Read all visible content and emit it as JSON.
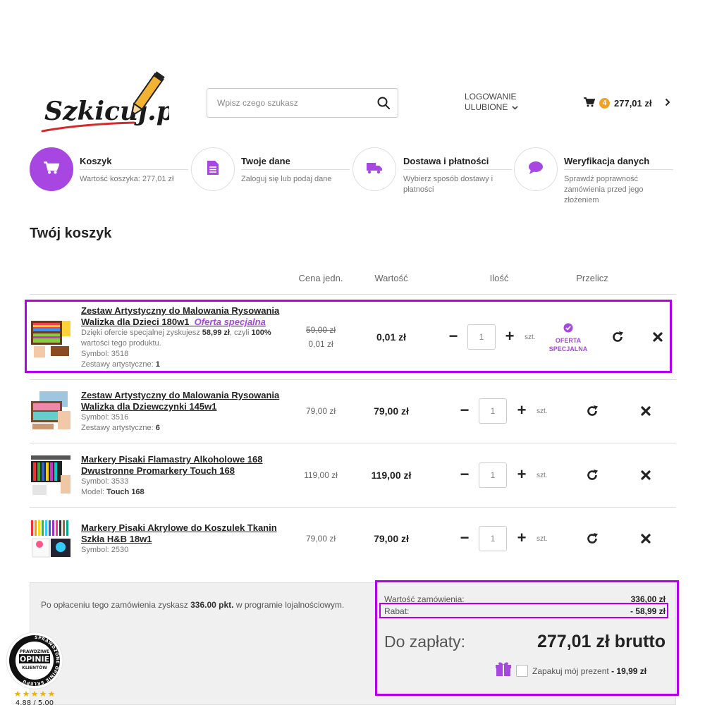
{
  "header": {
    "logo_text": "Szkicuj.pl",
    "search_placeholder": "Wpisz czego szukasz",
    "login_label": "LOGOWANIE",
    "favorites_label": "ULUBIONE",
    "cart_count": "4",
    "cart_total": "277,01 zł"
  },
  "steps": [
    {
      "title": "Koszyk",
      "desc": "Wartość koszyka: 277,01 zł",
      "icon": "cart-icon",
      "active": true
    },
    {
      "title": "Twoje dane",
      "desc": "Zaloguj się lub podaj dane",
      "icon": "document-icon",
      "active": false
    },
    {
      "title": "Dostawa i płatności",
      "desc": "Wybierz sposób dostawy i płatności",
      "icon": "truck-icon",
      "active": false
    },
    {
      "title": "Weryfikacja danych",
      "desc": "Sprawdź poprawność zamówienia przed jego złożeniem",
      "icon": "chat-icon",
      "active": false
    }
  ],
  "page_title": "Twój koszyk",
  "table_headers": {
    "price": "Cena jedn.",
    "value": "Wartość",
    "qty": "Ilość",
    "recalc": "Przelicz"
  },
  "items": [
    {
      "name_line1": "Zestaw Artystyczny do Malowania Rysowania",
      "name_line2": "Walizka dla Dzieci 180w1",
      "special_label": "Oferta specjalna",
      "offer_text_a": "Dzięki ofercie specjalnej zyskujesz ",
      "offer_amount": "58,99 zł",
      "offer_text_b": ", czyli ",
      "offer_percent": "100%",
      "offer_text_c": "wartości tego produktu.",
      "symbol": "Symbol: 3518",
      "attr_label": "Zestawy artystyczne: ",
      "attr_value": "1",
      "old_price": "59,00 zł",
      "price": "0,01 zł",
      "value": "0,01 zł",
      "qty": "1",
      "unit": "szt.",
      "offer_badge": "OFERTA SPECJALNA"
    },
    {
      "name_line1": "Zestaw Artystyczny do Malowania Rysowania",
      "name_line2": "Walizka dla Dziewczynki 145w1",
      "symbol": "Symbol: 3516",
      "attr_label": "Zestawy artystyczne: ",
      "attr_value": "6",
      "price": "79,00 zł",
      "value": "79,00 zł",
      "qty": "1",
      "unit": "szt."
    },
    {
      "name_line1": "Markery Pisaki Flamastry Alkoholowe 168",
      "name_line2": "Dwustronne Promarkery Touch 168",
      "symbol": "Symbol: 3533",
      "attr_label": "Model: ",
      "attr_value": "Touch 168",
      "price": "119,00 zł",
      "value": "119,00 zł",
      "qty": "1",
      "unit": "szt."
    },
    {
      "name_line1": "Markery Pisaki Akrylowe do Koszulek Tkanin",
      "name_line2": "Szkła H&B 18w1",
      "symbol": "Symbol: 2530",
      "price": "79,00 zł",
      "value": "79,00 zł",
      "qty": "1",
      "unit": "szt."
    }
  ],
  "loyalty": {
    "text_a": "Po opłaceniu tego zamówienia zyskasz ",
    "points": "336.00 pkt.",
    "text_b": " w programie lojalnościowym."
  },
  "summary": {
    "order_value_label": "Wartość zamówienia:",
    "order_value": "336,00 zł",
    "discount_label": "Rabat:",
    "discount": "- 58,99 zł",
    "to_pay_label": "Do zapłaty:",
    "to_pay": "277,01 zł brutto",
    "gift_label": "Zapakuj mój prezent",
    "gift_price": "- 19,99 zł"
  },
  "rating": {
    "line1": "PRAWDZIWE",
    "line2": "OPINIE",
    "line3": "KLIENTÓW",
    "ring_text": "SPRAWDZONE OPINIE SKLEPU",
    "score": "4.88 / 5.00"
  },
  "colors": {
    "accent": "#a746e0",
    "highlight": "#b300e6",
    "badge": "#f1a320"
  }
}
